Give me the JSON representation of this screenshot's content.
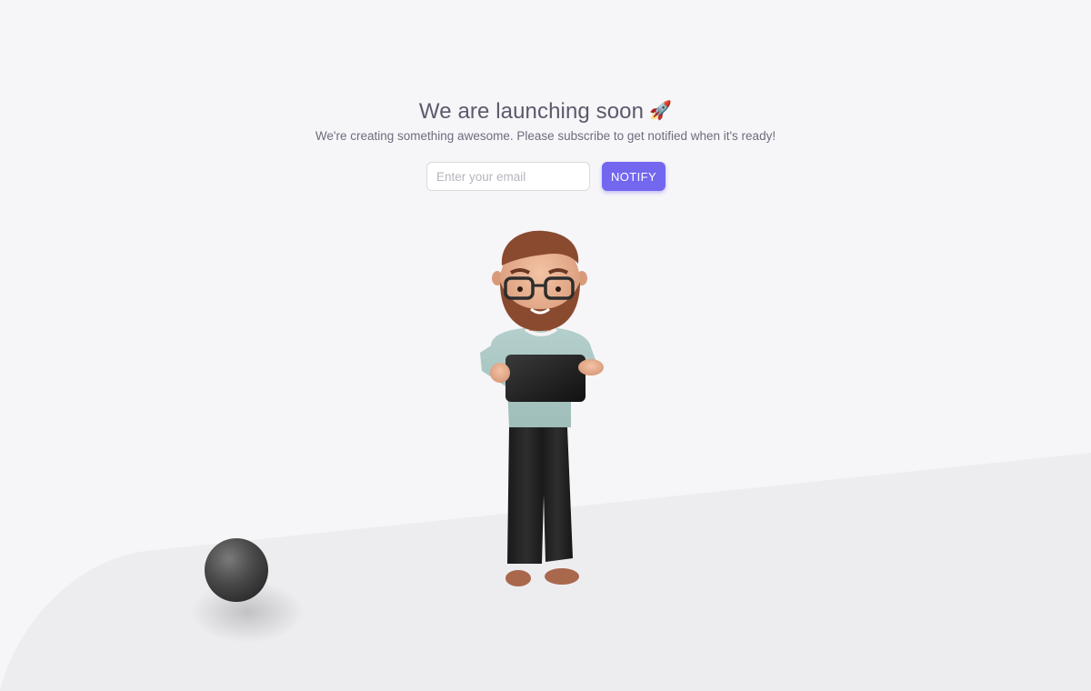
{
  "hero": {
    "title": "We are launching soon",
    "title_emoji": "🚀",
    "subtitle": "We're creating something awesome. Please subscribe to get notified when it's ready!"
  },
  "subscribe": {
    "email_placeholder": "Enter your email",
    "email_value": "",
    "notify_label": "NOTIFY"
  },
  "colors": {
    "background": "#f6f6f8",
    "floor": "#ededf0",
    "primary": "#7367f0",
    "heading": "#5d596c",
    "body_text": "#6f6b7d"
  },
  "illustration": {
    "character": "bearded-man-holding-tablet",
    "object": "dark-sphere"
  }
}
